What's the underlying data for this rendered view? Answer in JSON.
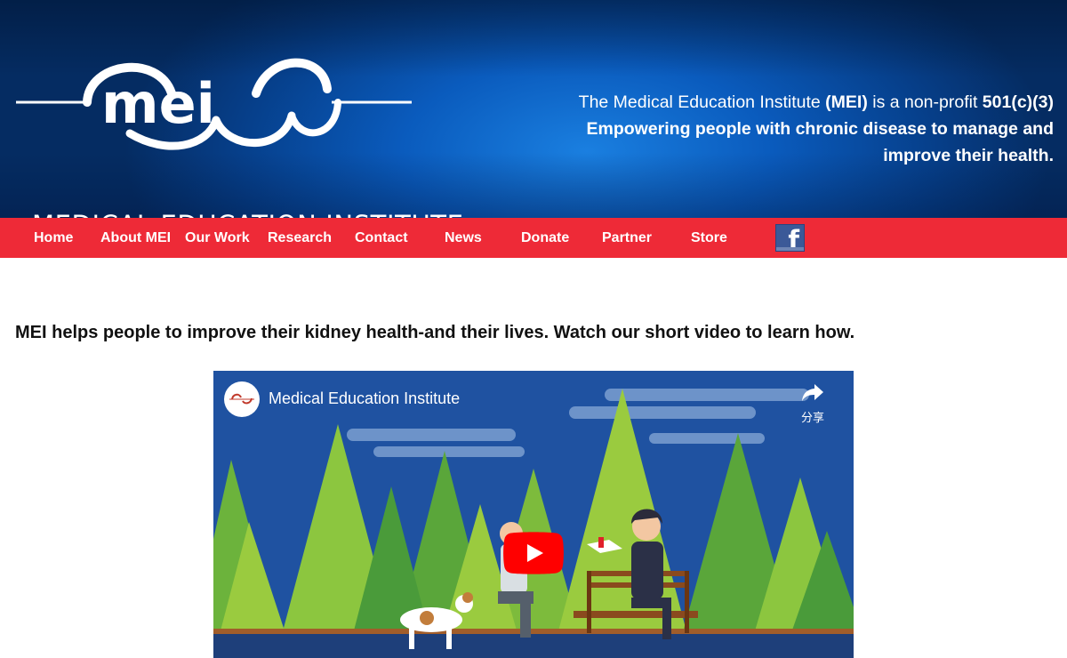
{
  "header": {
    "logo_word": "mei",
    "logo_text": "MEDICAL EDUCATION INSTITUTE",
    "tagline_part1": "The Medical Education Institute ",
    "tagline_abbr": "(MEI)",
    "tagline_part2": " is a non-profit ",
    "tagline_status": "501(c)(3)",
    "tagline_line2": "Empowering people with chronic disease to manage and",
    "tagline_line3": "improve their health."
  },
  "nav": {
    "items": [
      {
        "label": "Home"
      },
      {
        "label": "About MEI"
      },
      {
        "label": "Our Work"
      },
      {
        "label": "Research"
      },
      {
        "label": "Contact"
      },
      {
        "label": "News"
      },
      {
        "label": "Donate"
      },
      {
        "label": "Partner"
      },
      {
        "label": "Store"
      }
    ],
    "facebook_icon": "facebook-icon",
    "facebook_glyph": "f"
  },
  "main": {
    "intro": "MEI helps people to improve their kidney health-and their lives. Watch our short video to learn how."
  },
  "video": {
    "title": "Medical Education Institute",
    "share_label": "分享",
    "play_icon": "youtube-play-icon",
    "share_icon": "share-icon",
    "colors": {
      "play": "#ff0000",
      "sky": "#1d4f9e"
    }
  },
  "colors": {
    "header_blue": "#0a5bbd",
    "nav_red": "#ee2a37",
    "facebook": "#3b5998"
  }
}
